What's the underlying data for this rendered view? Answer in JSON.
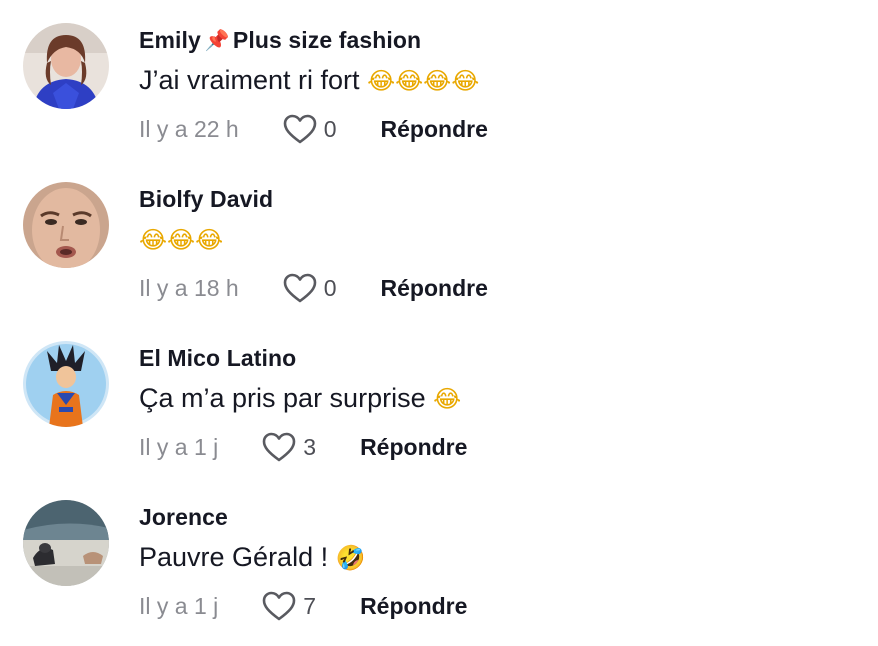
{
  "comments": [
    {
      "username": "Emily",
      "username_suffix": "Plus size fashion",
      "badge_icon": "pushpin-icon",
      "text": "J’ai vraiment ri fort",
      "emoji": "😂😂😂😂",
      "time": "Il y a 22 h",
      "likes": "0",
      "reply_label": "Répondre",
      "avatar_description": "woman-blue-shirt"
    },
    {
      "username": "Biolfy David",
      "text": "",
      "emoji": "😂😂😂",
      "time": "Il y a 18 h",
      "likes": "0",
      "reply_label": "Répondre",
      "avatar_description": "face-closeup"
    },
    {
      "username": "El Mico Latino",
      "text": "Ça m’a pris par surprise",
      "emoji": "😂",
      "time": "Il y a 1 j",
      "likes": "3",
      "reply_label": "Répondre",
      "avatar_description": "anime-character"
    },
    {
      "username": "Jorence",
      "text": "Pauvre Gérald !",
      "emoji": "🤣",
      "time": "Il y a 1 j",
      "likes": "7",
      "reply_label": "Répondre",
      "avatar_description": "outdoor-scene"
    }
  ],
  "colors": {
    "username": "#161823",
    "text": "#161823",
    "time": "#8a8b91",
    "reply": "#161823",
    "heart_outline": "#595a60"
  }
}
